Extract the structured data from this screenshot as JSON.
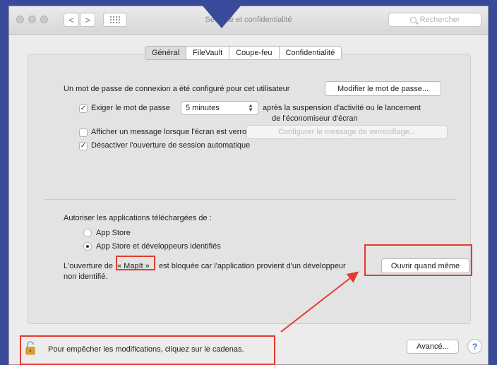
{
  "window": {
    "title": "Sécurité et confidentialité",
    "search_placeholder": "Rechercher",
    "nav_back": "<",
    "nav_forward": ">"
  },
  "tabs": [
    {
      "label": "Général",
      "active": true
    },
    {
      "label": "FileVault",
      "active": false
    },
    {
      "label": "Coupe-feu",
      "active": false
    },
    {
      "label": "Confidentialité",
      "active": false
    }
  ],
  "general": {
    "password_set_text": "Un mot de passe de connexion a été configuré pour cet utilisateur",
    "change_password_button": "Modifier le mot de passe...",
    "require_password_label": "Exiger le mot de passe",
    "require_password_checked": true,
    "require_password_delay": "5 minutes",
    "after_sleep_line1": "après la suspension d'activité ou le lancement",
    "after_sleep_line2": "de l'économiseur d'écran",
    "show_message_label": "Afficher un message lorsque l'écran est verrouillé",
    "show_message_checked": false,
    "configure_message_button": "Configurer le message de verrouillage...",
    "disable_autologin_label": "Désactiver l'ouverture de session automatique",
    "disable_autologin_checked": true
  },
  "downloads": {
    "heading": "Autoriser les applications téléchargées de :",
    "options": [
      {
        "label": "App Store",
        "selected": false
      },
      {
        "label": "App Store et développeurs identifiés",
        "selected": true
      }
    ],
    "blocked_prefix": "L'ouverture de",
    "blocked_app": "« MapIt »",
    "blocked_suffix": "est bloquée car l'application provient d'un développeur",
    "blocked_line2": "non identifié.",
    "open_anyway_button": "Ouvrir quand même"
  },
  "footer": {
    "lock_text": "Pour empêcher les modifications, cliquez sur le cadenas.",
    "advanced_button": "Avancé...",
    "help_label": "?"
  },
  "colors": {
    "highlight": "#e53a2e",
    "background": "#3a4a9a",
    "help_blue": "#3d6fd8",
    "lock_gold": "#e0a030"
  },
  "icons": [
    "search-icon",
    "grid-icon",
    "lock-icon",
    "help-icon",
    "stepper-icon",
    "checkmark-icon"
  ]
}
